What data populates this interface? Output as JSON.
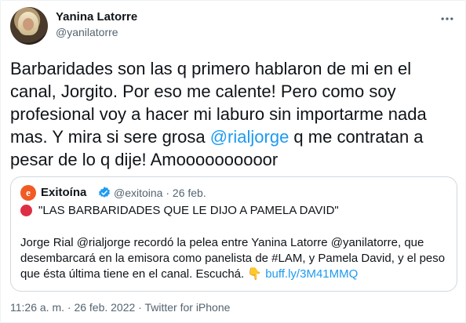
{
  "author": {
    "name": "Yanina Latorre",
    "handle": "@yanilatorre"
  },
  "tweet": {
    "part1": "Barbaridades son las q primero hablaron de mi en el canal, Jorgito. Por eso me calente! Pero como soy profesional voy a hacer mi laburo sin importarme nada mas. Y mira si sere grosa ",
    "mention": "@rialjorge",
    "part2": " q me contratan a pesar de lo q dije! Amoooooooooor"
  },
  "quote": {
    "avatar_letter": "e",
    "name": "Exitoína",
    "handle_date": "@exitoina · 26 feb.",
    "headline": "\"LAS BARBARIDADES QUE LE DIJO A PAMELA DAVID\"",
    "body": "Jorge Rial @rialjorge recordó la pelea entre Yanina Latorre @yanilatorre, que desembarcará en la emisora como panelista de #LAM, y Pamela David, y el peso que ésta última tiene en el canal. Escuchá. 👇 ",
    "link": "buff.ly/3M41MMQ"
  },
  "meta": "11:26 a. m. · 26 feb. 2022 · Twitter for iPhone",
  "colors": {
    "accent": "#1d9bf0",
    "secondary_text": "#536471",
    "border": "#cfd9de",
    "quote_logo": "#f15a24",
    "red_dot": "#dd2e44"
  },
  "icons": {
    "more": "more-horizontal-icon",
    "verified": "verified-badge-icon",
    "red_circle": "red-circle-emoji"
  }
}
